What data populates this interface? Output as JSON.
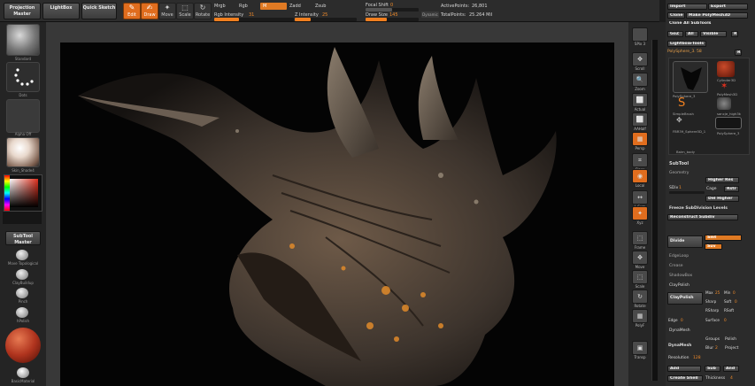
{
  "top_buttons": {
    "projection": "Projection Master",
    "lightbox": "LightBox",
    "quicksketch": "Quick Sketch"
  },
  "tools": [
    {
      "label": "Edit",
      "glyph": "✎",
      "on": true
    },
    {
      "label": "Draw",
      "glyph": "✍",
      "on": true
    },
    {
      "label": "Move",
      "glyph": "✦",
      "on": false
    },
    {
      "label": "Scale",
      "glyph": "⬚",
      "on": false
    },
    {
      "label": "Rotate",
      "glyph": "↻",
      "on": false
    }
  ],
  "sliders": {
    "mrgb": "Mrgb",
    "rgb": "Rgb",
    "m": "M",
    "zadd": "Zadd",
    "zsub": "Zsub",
    "rgb_intensity_label": "Rgb Intensity",
    "rgb_intensity": "31",
    "z_intensity_label": "Z Intensity",
    "z_intensity": "25",
    "focal_label": "Focal Shift",
    "focal": "0",
    "draw_size_label": "Draw Size",
    "draw_size": "145",
    "dynamic": "Dynamic",
    "active_points_label": "ActivePoints:",
    "active_points": "26,801",
    "total_points_label": "TotalPoints:",
    "total_points": "25.264 Mil"
  },
  "left_panel": {
    "brush": "Standard",
    "stroke": "Dots",
    "alpha": "Alpha Off",
    "material": "Skin_Shade4",
    "subtool_master": "SubTool Master",
    "move_topo": "Move Topological",
    "claybuildup": "ClayBuildup",
    "pinch": "Pinch",
    "hpolish": "hPolish",
    "basicmaterial": "BasicMaterial"
  },
  "right_tools": [
    {
      "label": "SPix 3",
      "glyph": "",
      "on": false
    },
    {
      "label": "Scroll",
      "glyph": "✥",
      "on": false
    },
    {
      "label": "Zoom",
      "glyph": "🔍",
      "on": false
    },
    {
      "label": "Actual",
      "glyph": "⬜",
      "on": false
    },
    {
      "label": "AAHalf",
      "glyph": "⬜",
      "on": false
    },
    {
      "label": "Persp",
      "glyph": "▦",
      "on": true
    },
    {
      "label": "Floor",
      "glyph": "⌗",
      "on": false
    },
    {
      "label": "Local",
      "glyph": "◉",
      "on": true
    },
    {
      "label": "L.Sym",
      "glyph": "↔",
      "on": false
    },
    {
      "label": "Xyz",
      "glyph": "✦",
      "on": true
    },
    {
      "label": "Frame",
      "glyph": "⬚",
      "on": false
    },
    {
      "label": "Move",
      "glyph": "✥",
      "on": false
    },
    {
      "label": "Scale",
      "glyph": "⬚",
      "on": false
    },
    {
      "label": "Rotate",
      "glyph": "↻",
      "on": false
    },
    {
      "label": "PolyF",
      "glyph": "▦",
      "on": false
    },
    {
      "label": "Transp",
      "glyph": "▣",
      "on": false
    }
  ],
  "tray": {
    "import": "Import",
    "export": "Export",
    "clone": "Clone",
    "make_polymesh": "Make PolyMesh3D",
    "clone_all": "Clone All SubTools",
    "goz": "GoZ",
    "all": "All",
    "visible": "Visible",
    "r": "R",
    "lightbox_tools": "Lightbox▸Tools",
    "polysphere": "PolySphere_3. 58",
    "thumbs": [
      "PolySphere_3",
      "Cylinder3D",
      "PolyMesh3D",
      "SimpleBrush",
      "sancje_high3k",
      "FBR39_Sphere3D_1",
      "PolySphere_3",
      "Balm_body"
    ],
    "subtool": "SubTool",
    "geometry": "Geometry",
    "higher_res": "Higher Res",
    "sdiv_label": "SDiv",
    "sdiv": "1",
    "cage": "Cage",
    "rstr": "Rstr",
    "del_higher": "Del Higher",
    "freeze": "Freeze SubDivision Levels",
    "reconstruct": "Reconstruct Subdiv",
    "divide": "Divide",
    "smt": "Smt",
    "suv": "Suv",
    "edgeloop": "EdgeLoop",
    "crease": "Crease",
    "shadowbox": "ShadowBox",
    "claypolish_head": "ClayPolish",
    "claypolish": "ClayPolish",
    "max_label": "Max",
    "max": "25",
    "min_label": "Min",
    "min": "0",
    "sharp": "Sharp",
    "soft": "Soft",
    "soft_val": "0",
    "rsharp": "RSharp",
    "rsoft": "RSoft",
    "edge_label": "Edge",
    "edge": "0",
    "surface_label": "Surface",
    "surface": "0",
    "dynamesh_head": "DynaMesh",
    "dynamesh": "DynaMesh",
    "groups": "Groups",
    "polish": "Polish",
    "blur_label": "Blur",
    "blur": "2",
    "project": "Project",
    "resolution_label": "Resolution",
    "resolution": "128",
    "add": "Add",
    "sub": "Sub",
    "and": "And",
    "create_shell": "Create Shell",
    "thickness_label": "Thickness",
    "thickness": "4"
  },
  "colors": {
    "accent": "#e06d1e",
    "panel": "#2b2b2b",
    "document": "#040404"
  }
}
